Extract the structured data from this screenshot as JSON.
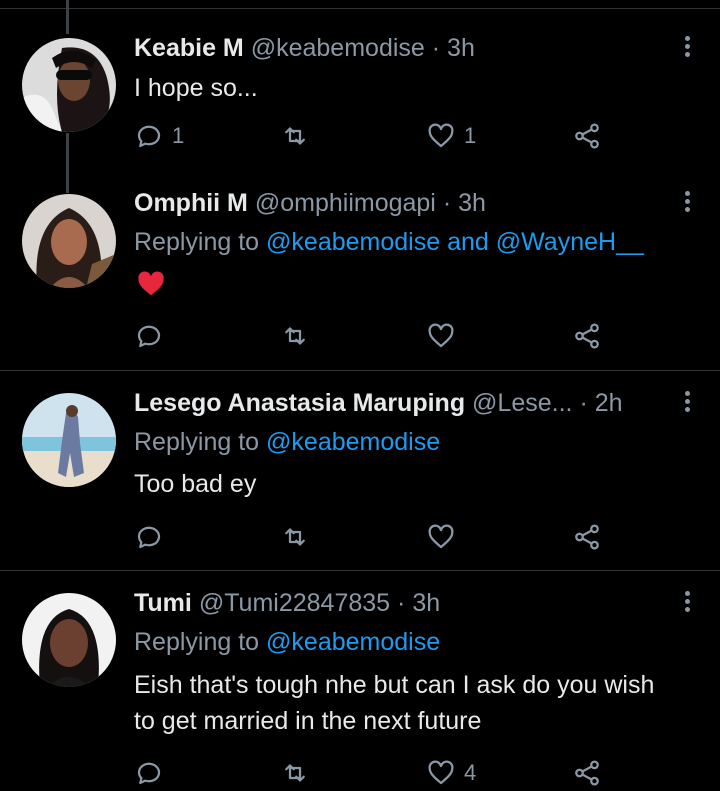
{
  "tweets": [
    {
      "name": "Keabie M",
      "handle": "@keabemodise",
      "separator": "·",
      "time": "3h",
      "replying_prefix": "",
      "mentions": [],
      "text": "I hope so...",
      "reply_count": "1",
      "retweet_count": "",
      "like_count": "1"
    },
    {
      "name": "Omphii M",
      "handle": "@omphiimogapi",
      "separator": "·",
      "time": "3h",
      "replying_prefix": "Replying to",
      "mentions": [
        "@keabemodise",
        "and",
        "@WayneH__"
      ],
      "text": "",
      "emoji": "red-heart",
      "reply_count": "",
      "retweet_count": "",
      "like_count": ""
    },
    {
      "name": "Lesego Anastasia Maruping",
      "handle": "@Lese...",
      "separator": "·",
      "time": "2h",
      "replying_prefix": "Replying to",
      "mentions": [
        "@keabemodise"
      ],
      "text": "Too bad ey",
      "reply_count": "",
      "retweet_count": "",
      "like_count": ""
    },
    {
      "name": "Tumi",
      "handle": "@Tumi22847835",
      "separator": "·",
      "time": "3h",
      "replying_prefix": "Replying to",
      "mentions": [
        "@keabemodise"
      ],
      "text": "Eish that's tough nhe but can I ask do you wish to get married in the next future",
      "reply_count": "",
      "retweet_count": "",
      "like_count": "4"
    }
  ],
  "icons": {
    "reply": "reply-icon",
    "retweet": "retweet-icon",
    "like": "like-icon",
    "share": "share-icon",
    "more": "more-icon"
  },
  "colors": {
    "background": "#000000",
    "text": "#e7e9ea",
    "muted": "#8b98a5",
    "link": "#1d9bf0",
    "heart": "#f91880"
  }
}
